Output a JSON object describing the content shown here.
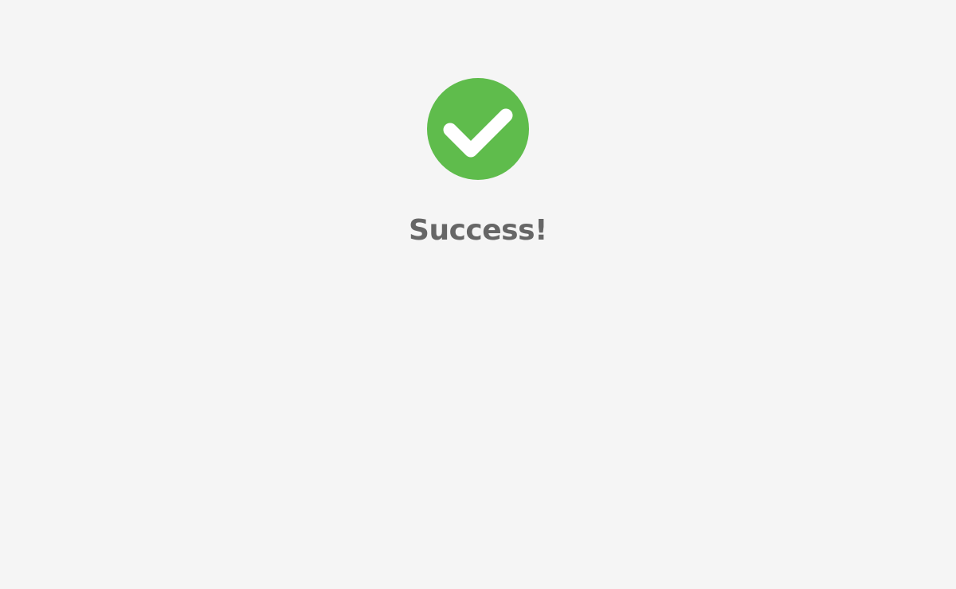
{
  "status": {
    "icon": "check-circle-icon",
    "title": "Success!"
  },
  "colors": {
    "background": "#f5f5f5",
    "accent": "#5fbc4c",
    "check": "#ffffff",
    "title_text": "#666666"
  }
}
